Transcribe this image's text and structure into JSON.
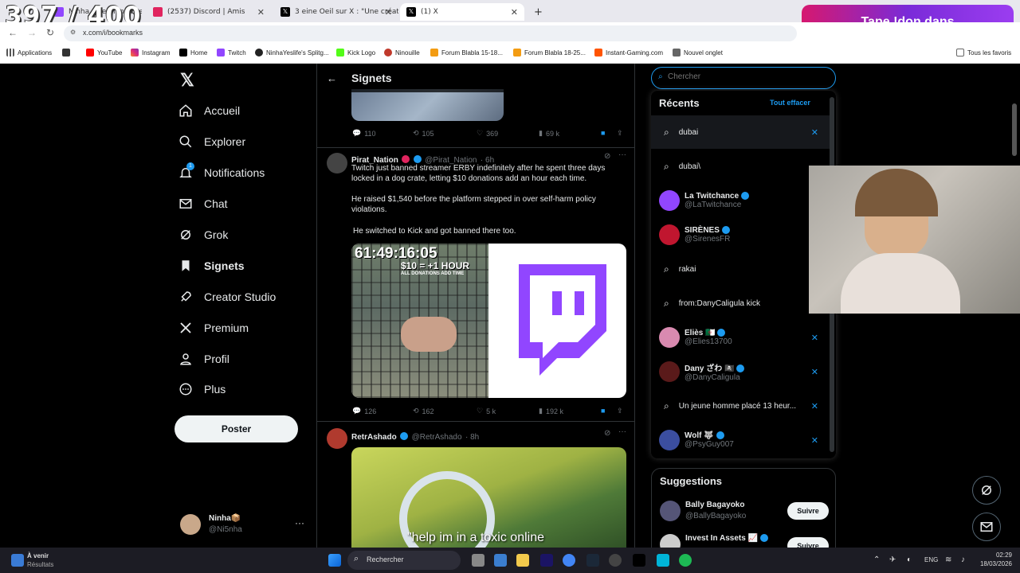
{
  "browser": {
    "tabs": [
      {
        "label": "Ninha Streaming live on Twitch"
      },
      {
        "label": "(2537) Discord | Amis"
      },
      {
        "label": "3 eine Oeil sur X : \"Une créatric"
      },
      {
        "label": "(1) X"
      }
    ],
    "new_tab_symbol": "+",
    "address": "x.com/i/bookmarks",
    "bookmarks": [
      "Applications",
      "YouTube",
      "Instagram",
      "Home",
      "Twitch",
      "NinhaYeslife's Splitg...",
      "Kick Logo",
      "Ninouille",
      "Forum Blabla 15-18...",
      "Forum Blabla 18-25...",
      "Instant-Gaming.com",
      "Nouvel onglet"
    ],
    "all_bookmarks": "Tous les favoris"
  },
  "overlay": {
    "counter": "397 / 400",
    "banner": "Tape !don dans"
  },
  "nav": {
    "items": [
      {
        "label": "Accueil",
        "icon": "home-icon"
      },
      {
        "label": "Explorer",
        "icon": "search-icon"
      },
      {
        "label": "Notifications",
        "icon": "bell-icon",
        "badge": "1"
      },
      {
        "label": "Chat",
        "icon": "mail-icon"
      },
      {
        "label": "Grok",
        "icon": "grok-icon"
      },
      {
        "label": "Signets",
        "icon": "bookmark-icon"
      },
      {
        "label": "Creator Studio",
        "icon": "rocket-icon"
      },
      {
        "label": "Premium",
        "icon": "x-icon"
      },
      {
        "label": "Profil",
        "icon": "person-icon"
      },
      {
        "label": "Plus",
        "icon": "more-icon"
      }
    ],
    "post_button": "Poster",
    "account": {
      "name": "Ninha📦",
      "handle": "@Ni5nha",
      "more": "···"
    }
  },
  "timeline": {
    "title": "Signets",
    "first_actions": {
      "replies": "110",
      "reposts": "105",
      "likes": "369",
      "views": "69 k"
    },
    "tweets": [
      {
        "name": "Pirat_Nation",
        "handle": "@Pirat_Nation",
        "time": "· 6h",
        "text1": "Twitch just banned streamer ERBY indefinitely after he spent three days locked in a dog crate, letting $10 donations add an hour each time.",
        "text2": "He raised $1,540 before the platform stepped in over self-harm policy violations.",
        "text3": "He switched to Kick and got banned there too.",
        "media_timer": "61:49:16:05",
        "media_caption": "$10 = +1 HOUR",
        "media_sub": "ALL DONATIONS ADD TIME",
        "actions": {
          "replies": "126",
          "reposts": "162",
          "likes": "5 k",
          "views": "192 k"
        }
      },
      {
        "name": "RetrAshado",
        "handle": "@RetrAshado",
        "time": "· 8h",
        "caption": "\"help im in a toxic online"
      }
    ]
  },
  "search": {
    "placeholder": "Chercher",
    "recent_title": "Récents",
    "clear_all": "Tout effacer",
    "items": [
      {
        "type": "query",
        "text": "dubai"
      },
      {
        "type": "query",
        "text": "dubai\\"
      },
      {
        "type": "user",
        "name": "La Twitchance",
        "handle": "@LaTwitchance"
      },
      {
        "type": "user",
        "name": "SIRÈNES",
        "handle": "@SirenesFR"
      },
      {
        "type": "query",
        "text": "rakai"
      },
      {
        "type": "query",
        "text": "from:DanyCaligula kick"
      },
      {
        "type": "user",
        "name": "Eliès 🇩🇿",
        "handle": "@Elies13700"
      },
      {
        "type": "user",
        "name": "Dany ざわ 🏴‍☠️",
        "handle": "@DanyCaligula"
      },
      {
        "type": "query",
        "text": "Un jeune homme placé 13 heur..."
      },
      {
        "type": "user",
        "name": "Wolf 🐺",
        "handle": "@PsyGuy007"
      }
    ]
  },
  "suggestions": {
    "title": "Suggestions",
    "users": [
      {
        "name": "Bally Bagayoko",
        "handle": "@BallyBagayoko",
        "follow": "Suivre"
      },
      {
        "name": "Invest In Assets 📈",
        "handle": "",
        "follow": "Suivre"
      }
    ]
  },
  "taskbar": {
    "weather_title": "À venir",
    "weather_sub": "Résultats",
    "search": "Rechercher",
    "lang": "ENG",
    "time": "02:29",
    "date": "18/03/2026"
  }
}
